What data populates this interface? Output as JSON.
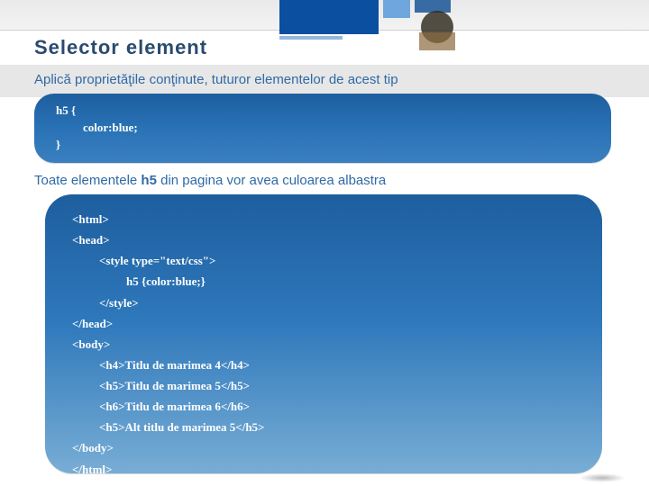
{
  "header": {
    "title": "Selector  element"
  },
  "subtitle1": "Aplică proprietăţile conţinute, tuturor elementelor de acest tip",
  "code1": {
    "line1": "h5 {",
    "line2": "color:blue;",
    "line3": "}"
  },
  "subtitle2": {
    "prefix": "Toate elementele ",
    "bold": "h5",
    "suffix": " din pagina vor avea culoarea albastra"
  },
  "code2": {
    "l01": "<html>",
    "l02": "<head>",
    "l03": "<style type=\"text/css\">",
    "l04": "h5 {color:blue;}",
    "l05": "</style>",
    "l06": "</head>",
    "l07": "<body>",
    "l08": "<h4>Titlu de marimea 4</h4>",
    "l09": "<h5>Titlu de marimea 5</h5>",
    "l10": "<h6>Titlu de marimea 6</h6>",
    "l11": "<h5>Alt titlu de marimea 5</h5>",
    "l12": "</body>",
    "l13": "</html>"
  }
}
